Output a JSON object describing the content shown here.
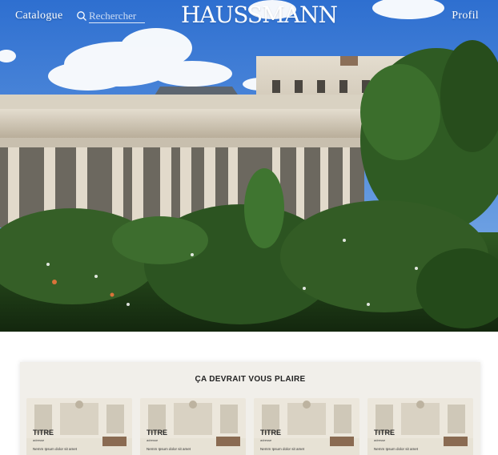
{
  "header": {
    "nav_left": "Catalogue",
    "search": {
      "placeholder": "Rechercher",
      "icon": "search-icon"
    },
    "logo": "HAUSSMANN",
    "nav_right": "Profil"
  },
  "hero": {
    "image": "palais-royal-garden-photo"
  },
  "recommendations": {
    "title": "ÇA DEVRAIT VOUS PLAIRE",
    "cards": [
      {
        "title": "TITRE",
        "subtitle": "adresse",
        "text": "Nemm Ipsum dolor sit amet"
      },
      {
        "title": "TITRE",
        "subtitle": "adresse",
        "text": "Nemm Ipsum dolor sit amet"
      },
      {
        "title": "TITRE",
        "subtitle": "adresse",
        "text": "Nemm Ipsum dolor sit amet"
      },
      {
        "title": "TITRE",
        "subtitle": "adresse",
        "text": "Nemm Ipsum dolor sit amet"
      }
    ]
  },
  "colors": {
    "section_background": "#f1efea",
    "header_text": "#ffffff",
    "title_text": "#222222"
  }
}
